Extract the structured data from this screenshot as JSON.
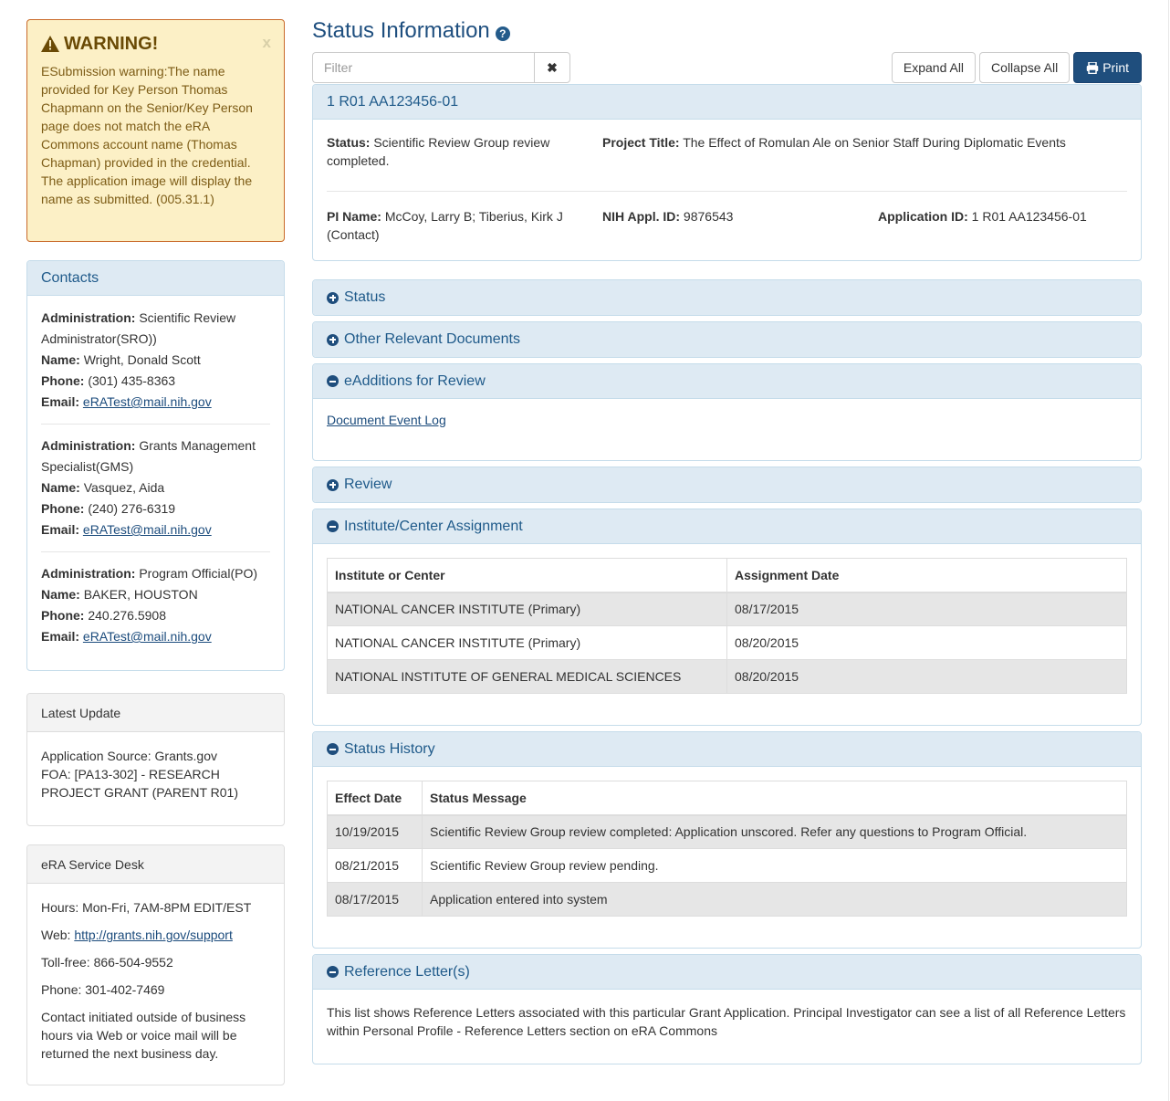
{
  "warning": {
    "icon": "warning-triangle-icon",
    "title": "WARNING!",
    "close_label": "x",
    "message": "ESubmission warning:The name provided for Key Person Thomas Chapmann on the Senior/Key Person page does not match the eRA Commons account name (Thomas Chapman) provided in the credential. The application image will display the name as submitted. (005.31.1)"
  },
  "contacts": {
    "title": "Contacts",
    "items": [
      {
        "admin_label": "Administration:",
        "admin": "Scientific Review Administrator(SRO))",
        "name_label": "Name:",
        "name": "Wright, Donald Scott",
        "phone_label": "Phone:",
        "phone": "(301) 435-8363",
        "email_label": "Email:",
        "email": "eRATest@mail.nih.gov"
      },
      {
        "admin_label": "Administration:",
        "admin": "Grants Management Specialist(GMS)",
        "name_label": "Name:",
        "name": "Vasquez, Aida",
        "phone_label": "Phone:",
        "phone": "(240) 276-6319",
        "email_label": "Email:",
        "email": "eRATest@mail.nih.gov"
      },
      {
        "admin_label": "Administration:",
        "admin": "Program Official(PO)",
        "name_label": "Name:",
        "name": "BAKER, HOUSTON",
        "phone_label": "Phone:",
        "phone": "240.276.5908",
        "email_label": "Email:",
        "email": "eRATest@mail.nih.gov"
      }
    ]
  },
  "latest_update": {
    "title": "Latest Update",
    "source": "Application Source: Grants.gov",
    "foa": "FOA: [PA13-302] -  RESEARCH PROJECT GRANT (PARENT R01)"
  },
  "service_desk": {
    "title": "eRA Service Desk",
    "hours": "Hours: Mon-Fri, 7AM-8PM EDIT/EST",
    "web_label": "Web: ",
    "web_link": "http://grants.nih.gov/support",
    "tollfree": "Toll-free: 866-504-9552",
    "phone": "Phone: 301-402-7469",
    "note": "Contact initiated outside of business hours via Web or voice mail will be returned the next business day."
  },
  "main": {
    "title": "Status Information",
    "help_icon": "?",
    "filter_placeholder": "Filter",
    "filter_value": "",
    "clear_icon": "✖",
    "expand_all": "Expand All",
    "collapse_all": "Collapse All",
    "print": "Print"
  },
  "application": {
    "heading": "1 R01 AA123456-01",
    "status_label": "Status:",
    "status": "Scientific Review Group review completed.",
    "project_title_label": "Project Title:",
    "project_title": "The Effect of Romulan Ale on Senior Staff During Diplomatic Events",
    "pi_label": "PI Name:",
    "pi": "McCoy, Larry B; Tiberius, Kirk J (Contact)",
    "nih_id_label": "NIH Appl. ID:",
    "nih_id": "9876543",
    "app_id_label": "Application ID:",
    "app_id": "1 R01 AA123456-01"
  },
  "sections": {
    "status": {
      "title": "Status",
      "expanded": false
    },
    "other_docs": {
      "title": "Other Relevant Documents",
      "expanded": false
    },
    "eadditions": {
      "title": "eAdditions for Review",
      "expanded": true,
      "link": "Document Event Log"
    },
    "review": {
      "title": "Review",
      "expanded": false
    },
    "ic_assignment": {
      "title": "Institute/Center Assignment",
      "expanded": true,
      "columns": [
        "Institute or Center",
        "Assignment Date"
      ],
      "rows": [
        [
          "NATIONAL CANCER INSTITUTE (Primary)",
          "08/17/2015"
        ],
        [
          "NATIONAL CANCER INSTITUTE (Primary)",
          "08/20/2015"
        ],
        [
          "NATIONAL INSTITUTE OF GENERAL MEDICAL SCIENCES",
          "08/20/2015"
        ]
      ]
    },
    "status_history": {
      "title": "Status History",
      "expanded": true,
      "columns": [
        "Effect Date",
        "Status Message"
      ],
      "rows": [
        [
          "10/19/2015",
          "Scientific Review Group review completed: Application unscored. Refer any questions to Program Official."
        ],
        [
          "08/21/2015",
          "Scientific Review Group review pending."
        ],
        [
          "08/17/2015",
          "Application entered into system"
        ]
      ]
    },
    "reference_letters": {
      "title": "Reference Letter(s)",
      "expanded": true,
      "text": "This list shows Reference Letters associated with this particular Grant Application. Principal Investigator can see a list of all Reference Letters within Personal Profile - Reference Letters section on eRA Commons"
    }
  },
  "colors": {
    "primary": "#1f4e7d",
    "panel_heading_bg": "#deeaf3",
    "warning_bg": "#fcf0c6",
    "warning_border": "#c96a2a"
  }
}
